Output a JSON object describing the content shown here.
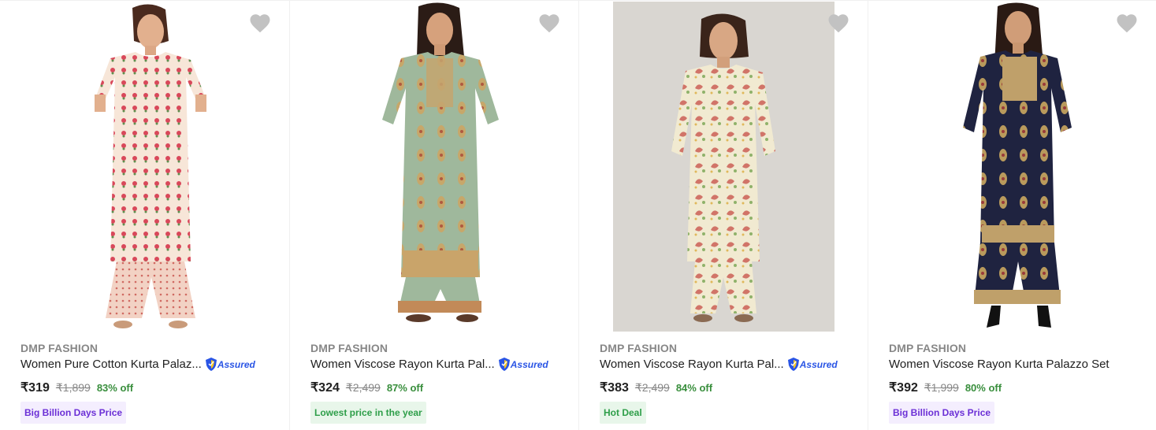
{
  "products": [
    {
      "brand": "DMP FASHION",
      "title": "Women Pure Cotton Kurta Palaz...",
      "assured": "Assured",
      "price": "₹319",
      "mrp": "₹1,899",
      "discount": "83% off",
      "badge": "Big Billion Days Price",
      "badge_style": "purple",
      "image_icon": "product-photo-pink-floral-kurta"
    },
    {
      "brand": "DMP FASHION",
      "title": "Women Viscose Rayon Kurta Pal...",
      "assured": "Assured",
      "price": "₹324",
      "mrp": "₹2,499",
      "discount": "87% off",
      "badge": "Lowest price in the year",
      "badge_style": "green",
      "image_icon": "product-photo-sage-green-kurta"
    },
    {
      "brand": "DMP FASHION",
      "title": "Women Viscose Rayon Kurta Pal...",
      "assured": "Assured",
      "price": "₹383",
      "mrp": "₹2,499",
      "discount": "84% off",
      "badge": "Hot Deal",
      "badge_style": "green",
      "image_icon": "product-photo-cream-paisley-kurta"
    },
    {
      "brand": "DMP FASHION",
      "title": "Women Viscose Rayon Kurta Palazzo Set",
      "assured": "",
      "price": "₹392",
      "mrp": "₹1,999",
      "discount": "80% off",
      "badge": "Big Billion Days Price",
      "badge_style": "purple",
      "image_icon": "product-photo-navy-gold-kurta"
    }
  ],
  "colors": {
    "discount_green": "#388e3c",
    "assured_blue": "#2a55e5",
    "wishlist_heart": "#c2c2c2",
    "brand_grey": "#878787"
  }
}
